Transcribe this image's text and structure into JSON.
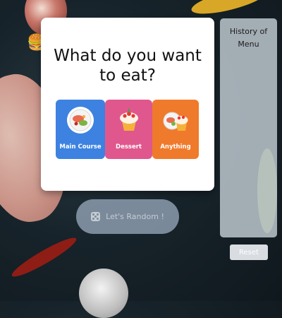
{
  "prompt": {
    "title_line1": "What do you want",
    "title_line2": "to eat?"
  },
  "categories": [
    {
      "label": "Main Course",
      "icon": "salad-plate-icon",
      "color": "#3d82e0"
    },
    {
      "label": "Dessert",
      "icon": "cupcake-icon",
      "color": "#e0578d"
    },
    {
      "label": "Anything",
      "icon": "mixed-food-icon",
      "color": "#f07a2c"
    }
  ],
  "random_button": {
    "label": "Let's Random !",
    "icon": "dice-icon"
  },
  "history": {
    "title_line1": "History of",
    "title_line2": "Menu"
  },
  "reset_button": {
    "label": "Reset"
  }
}
